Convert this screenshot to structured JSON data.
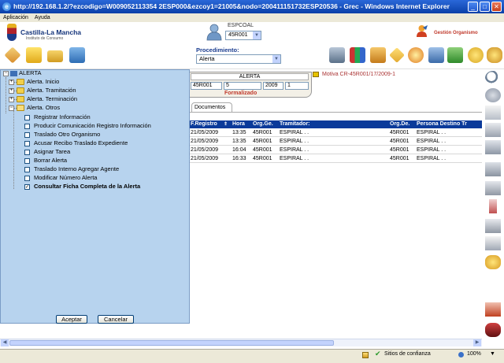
{
  "window": {
    "title": "http://192.168.1.2/?ezcodigo=W009052113354 2ESP000&ezcoy1=21005&nodo=200411151732ESP20536 - Grec - Windows Internet Explorer",
    "min_glyph": "_",
    "max_glyph": "□",
    "close_glyph": "✕"
  },
  "menubar": {
    "items": [
      "Aplicación",
      "Ayuda"
    ]
  },
  "header": {
    "logo_title": "Castilla-La Mancha",
    "logo_subtitle": "Instituto de Consumo",
    "user_name": "ESPCOAL",
    "user_office": "45R001",
    "gestion_label": "Gestión Organismo"
  },
  "procedimiento": {
    "label": "Procedimiento:",
    "value": "Alerta"
  },
  "alerta_card": {
    "title": "ALERTA",
    "org": "45R001",
    "num": "5",
    "year": "2009",
    "seq": "1",
    "status": "Formalizado",
    "motiva": "Motiva CR-45R001/17/2009-1"
  },
  "tabs": {
    "documentos": "Documentos"
  },
  "table": {
    "headers": [
      "F.Registro",
      "Hora",
      "Org.Ge.",
      "Tramitador:",
      "Org.De.",
      "Persona Destino Tr"
    ],
    "rows": [
      [
        "21/05/2009",
        "13:35",
        "45R001",
        "ESPIRAL . .",
        "45R001",
        "ESPIRAL . ."
      ],
      [
        "21/05/2009",
        "13:35",
        "45R001",
        "ESPIRAL . .",
        "45R001",
        "ESPIRAL . ."
      ],
      [
        "21/05/2009",
        "16:04",
        "45R001",
        "ESPIRAL . .",
        "45R001",
        "ESPIRAL . ."
      ],
      [
        "21/05/2009",
        "16:33",
        "45R001",
        "ESPIRAL . .",
        "45R001",
        "ESPIRAL . ."
      ]
    ]
  },
  "tree": {
    "root": "ALERTA",
    "folders": [
      "Alerta. Inicio",
      "Alerta. Tramitación",
      "Alerta. Terminación",
      "Alerta. Otros"
    ],
    "items": [
      {
        "label": "Registrar Información",
        "checked": false
      },
      {
        "label": "Producir Comunicación Registro Información",
        "checked": false
      },
      {
        "label": "Traslado Otro Organismo",
        "checked": false
      },
      {
        "label": "Acusar Recibo Traslado Expediente",
        "checked": false
      },
      {
        "label": "Asignar Tarea",
        "checked": false
      },
      {
        "label": "Borrar Alerta",
        "checked": false
      },
      {
        "label": "Traslado Interno Agregar Agente",
        "checked": false
      },
      {
        "label": "Modificar Número Alerta",
        "checked": false
      },
      {
        "label": "Consultar Ficha Completa de la Alerta",
        "checked": true
      }
    ],
    "accept_label": "Aceptar",
    "cancel_label": "Cancelar"
  },
  "statusbar": {
    "zone": "Sitios de confianza",
    "zoom": "100%"
  }
}
